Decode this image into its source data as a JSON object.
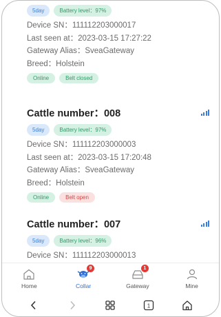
{
  "cards": [
    {
      "title": "",
      "tags": {
        "age": "5day",
        "battery": "Battery level：97%"
      },
      "device_sn": "Device SN：111112203000017",
      "last_seen": "Last seen at：2023-03-15 17:27:22",
      "gateway": "Gateway Alias：SveaGateway",
      "breed": "Breed：Holstein",
      "status": {
        "online": "Online",
        "belt": "Belt closed"
      }
    },
    {
      "title": "Cattle number：008",
      "tags": {
        "age": "5day",
        "battery": "Battery level：97%"
      },
      "device_sn": "Device SN：111112203000003",
      "last_seen": "Last seen at：2023-03-15 17:20:48",
      "gateway": "Gateway Alias：SveaGateway",
      "breed": "Breed：Holstein",
      "status": {
        "online": "Online",
        "belt": "Belt open"
      }
    },
    {
      "title": "Cattle number：007",
      "tags": {
        "age": "5day",
        "battery": "Battery level：96%"
      },
      "device_sn": "Device SN：111112203000013"
    }
  ],
  "tabbar": {
    "home": "Home",
    "collar": "Collar",
    "collar_badge": "9",
    "gateway": "Gateway",
    "gateway_badge": "1",
    "mine": "Mine"
  },
  "sysnav": {
    "tabs_count": "1"
  },
  "colors": {
    "accent": "#2f6fd6",
    "online": "#2f9b68",
    "belt_open": "#d64545",
    "badge": "#e53935"
  }
}
